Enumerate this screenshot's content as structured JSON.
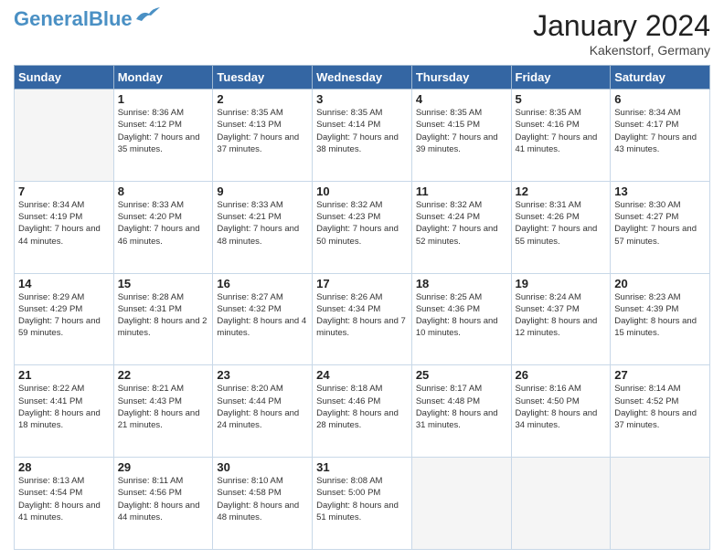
{
  "header": {
    "logo_line1": "General",
    "logo_line2": "Blue",
    "title": "January 2024",
    "subtitle": "Kakenstorf, Germany"
  },
  "days_of_week": [
    "Sunday",
    "Monday",
    "Tuesday",
    "Wednesday",
    "Thursday",
    "Friday",
    "Saturday"
  ],
  "weeks": [
    [
      {
        "num": "",
        "sunrise": "",
        "sunset": "",
        "daylight": ""
      },
      {
        "num": "1",
        "sunrise": "Sunrise: 8:36 AM",
        "sunset": "Sunset: 4:12 PM",
        "daylight": "Daylight: 7 hours and 35 minutes."
      },
      {
        "num": "2",
        "sunrise": "Sunrise: 8:35 AM",
        "sunset": "Sunset: 4:13 PM",
        "daylight": "Daylight: 7 hours and 37 minutes."
      },
      {
        "num": "3",
        "sunrise": "Sunrise: 8:35 AM",
        "sunset": "Sunset: 4:14 PM",
        "daylight": "Daylight: 7 hours and 38 minutes."
      },
      {
        "num": "4",
        "sunrise": "Sunrise: 8:35 AM",
        "sunset": "Sunset: 4:15 PM",
        "daylight": "Daylight: 7 hours and 39 minutes."
      },
      {
        "num": "5",
        "sunrise": "Sunrise: 8:35 AM",
        "sunset": "Sunset: 4:16 PM",
        "daylight": "Daylight: 7 hours and 41 minutes."
      },
      {
        "num": "6",
        "sunrise": "Sunrise: 8:34 AM",
        "sunset": "Sunset: 4:17 PM",
        "daylight": "Daylight: 7 hours and 43 minutes."
      }
    ],
    [
      {
        "num": "7",
        "sunrise": "Sunrise: 8:34 AM",
        "sunset": "Sunset: 4:19 PM",
        "daylight": "Daylight: 7 hours and 44 minutes."
      },
      {
        "num": "8",
        "sunrise": "Sunrise: 8:33 AM",
        "sunset": "Sunset: 4:20 PM",
        "daylight": "Daylight: 7 hours and 46 minutes."
      },
      {
        "num": "9",
        "sunrise": "Sunrise: 8:33 AM",
        "sunset": "Sunset: 4:21 PM",
        "daylight": "Daylight: 7 hours and 48 minutes."
      },
      {
        "num": "10",
        "sunrise": "Sunrise: 8:32 AM",
        "sunset": "Sunset: 4:23 PM",
        "daylight": "Daylight: 7 hours and 50 minutes."
      },
      {
        "num": "11",
        "sunrise": "Sunrise: 8:32 AM",
        "sunset": "Sunset: 4:24 PM",
        "daylight": "Daylight: 7 hours and 52 minutes."
      },
      {
        "num": "12",
        "sunrise": "Sunrise: 8:31 AM",
        "sunset": "Sunset: 4:26 PM",
        "daylight": "Daylight: 7 hours and 55 minutes."
      },
      {
        "num": "13",
        "sunrise": "Sunrise: 8:30 AM",
        "sunset": "Sunset: 4:27 PM",
        "daylight": "Daylight: 7 hours and 57 minutes."
      }
    ],
    [
      {
        "num": "14",
        "sunrise": "Sunrise: 8:29 AM",
        "sunset": "Sunset: 4:29 PM",
        "daylight": "Daylight: 7 hours and 59 minutes."
      },
      {
        "num": "15",
        "sunrise": "Sunrise: 8:28 AM",
        "sunset": "Sunset: 4:31 PM",
        "daylight": "Daylight: 8 hours and 2 minutes."
      },
      {
        "num": "16",
        "sunrise": "Sunrise: 8:27 AM",
        "sunset": "Sunset: 4:32 PM",
        "daylight": "Daylight: 8 hours and 4 minutes."
      },
      {
        "num": "17",
        "sunrise": "Sunrise: 8:26 AM",
        "sunset": "Sunset: 4:34 PM",
        "daylight": "Daylight: 8 hours and 7 minutes."
      },
      {
        "num": "18",
        "sunrise": "Sunrise: 8:25 AM",
        "sunset": "Sunset: 4:36 PM",
        "daylight": "Daylight: 8 hours and 10 minutes."
      },
      {
        "num": "19",
        "sunrise": "Sunrise: 8:24 AM",
        "sunset": "Sunset: 4:37 PM",
        "daylight": "Daylight: 8 hours and 12 minutes."
      },
      {
        "num": "20",
        "sunrise": "Sunrise: 8:23 AM",
        "sunset": "Sunset: 4:39 PM",
        "daylight": "Daylight: 8 hours and 15 minutes."
      }
    ],
    [
      {
        "num": "21",
        "sunrise": "Sunrise: 8:22 AM",
        "sunset": "Sunset: 4:41 PM",
        "daylight": "Daylight: 8 hours and 18 minutes."
      },
      {
        "num": "22",
        "sunrise": "Sunrise: 8:21 AM",
        "sunset": "Sunset: 4:43 PM",
        "daylight": "Daylight: 8 hours and 21 minutes."
      },
      {
        "num": "23",
        "sunrise": "Sunrise: 8:20 AM",
        "sunset": "Sunset: 4:44 PM",
        "daylight": "Daylight: 8 hours and 24 minutes."
      },
      {
        "num": "24",
        "sunrise": "Sunrise: 8:18 AM",
        "sunset": "Sunset: 4:46 PM",
        "daylight": "Daylight: 8 hours and 28 minutes."
      },
      {
        "num": "25",
        "sunrise": "Sunrise: 8:17 AM",
        "sunset": "Sunset: 4:48 PM",
        "daylight": "Daylight: 8 hours and 31 minutes."
      },
      {
        "num": "26",
        "sunrise": "Sunrise: 8:16 AM",
        "sunset": "Sunset: 4:50 PM",
        "daylight": "Daylight: 8 hours and 34 minutes."
      },
      {
        "num": "27",
        "sunrise": "Sunrise: 8:14 AM",
        "sunset": "Sunset: 4:52 PM",
        "daylight": "Daylight: 8 hours and 37 minutes."
      }
    ],
    [
      {
        "num": "28",
        "sunrise": "Sunrise: 8:13 AM",
        "sunset": "Sunset: 4:54 PM",
        "daylight": "Daylight: 8 hours and 41 minutes."
      },
      {
        "num": "29",
        "sunrise": "Sunrise: 8:11 AM",
        "sunset": "Sunset: 4:56 PM",
        "daylight": "Daylight: 8 hours and 44 minutes."
      },
      {
        "num": "30",
        "sunrise": "Sunrise: 8:10 AM",
        "sunset": "Sunset: 4:58 PM",
        "daylight": "Daylight: 8 hours and 48 minutes."
      },
      {
        "num": "31",
        "sunrise": "Sunrise: 8:08 AM",
        "sunset": "Sunset: 5:00 PM",
        "daylight": "Daylight: 8 hours and 51 minutes."
      },
      {
        "num": "",
        "sunrise": "",
        "sunset": "",
        "daylight": ""
      },
      {
        "num": "",
        "sunrise": "",
        "sunset": "",
        "daylight": ""
      },
      {
        "num": "",
        "sunrise": "",
        "sunset": "",
        "daylight": ""
      }
    ]
  ]
}
